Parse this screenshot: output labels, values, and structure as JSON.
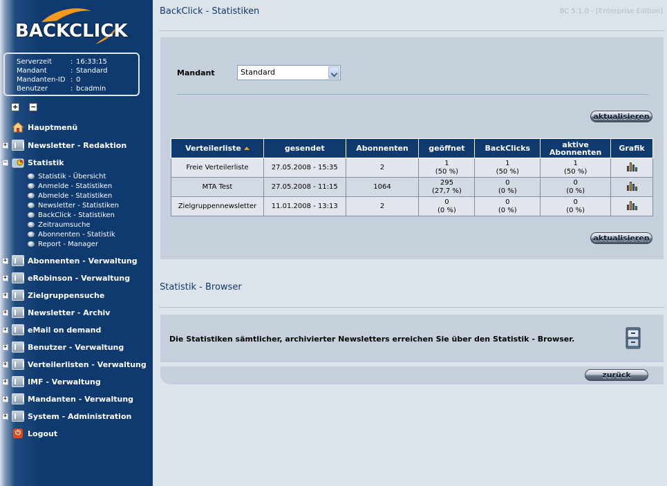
{
  "logo_text": "BACKCLICK",
  "server_info": [
    {
      "key": "Serverzeit",
      "value": "16:33:15"
    },
    {
      "key": "Mandant",
      "value": "Standard"
    },
    {
      "key": "Mandanten-ID",
      "value": "0"
    },
    {
      "key": "Benutzer",
      "value": "bcadmin"
    }
  ],
  "info_separator": ":",
  "tree_controls": {
    "expand": "+",
    "collapse": "−"
  },
  "nav": {
    "hauptmenue": "Hauptmenü",
    "newsletter_redaktion": "Newsletter - Redaktion",
    "statistik": "Statistik",
    "statistik_sub": [
      "Statistik - Übersicht",
      "Anmelde - Statistiken",
      "Abmelde - Statistiken",
      "Newsletter - Statistiken",
      "BackClick - Statistiken",
      "Zeitraumsuche",
      "Abonnenten - Statistik",
      "Report - Manager"
    ],
    "abonnenten_verwaltung": "Abonnenten - Verwaltung",
    "erobinson_verwaltung": "eRobinson - Verwaltung",
    "zielgruppensuche": "Zielgruppensuche",
    "newsletter_archiv": "Newsletter - Archiv",
    "email_on_demand": "eMail on demand",
    "benutzer_verwaltung": "Benutzer - Verwaltung",
    "verteilerlisten_verwaltung": "Verteilerlisten - Verwaltung",
    "imf_verwaltung": "IMF - Verwaltung",
    "mandanten_verwaltung": "Mandanten - Verwaltung",
    "system_administration": "System - Administration",
    "logout": "Logout",
    "toggle_plus": "+",
    "toggle_minus": "−",
    "logout_icon_glyph": "⏻"
  },
  "page_title": "BackClick - Statistiken",
  "version": "BC 5.1.0 - [Enterprise Edition]",
  "mandant": {
    "label": "Mandant",
    "selected": "Standard"
  },
  "buttons": {
    "refresh": "aktualisieren",
    "back": "zurück"
  },
  "table": {
    "headers": {
      "verteilerliste": "Verteilerliste",
      "gesendet": "gesendet",
      "abonnenten": "Abonnenten",
      "geoeffnet": "geöffnet",
      "backclicks": "BackClicks",
      "aktive_1": "aktive",
      "aktive_2": "Abonnenten",
      "grafik": "Grafik"
    },
    "rows": [
      {
        "liste": "Freie Verteilerliste",
        "gesendet": "27.05.2008 - 15:35",
        "abonnenten": "2",
        "geoeffnet_n": "1",
        "geoeffnet_p": "(50 %)",
        "backclicks_n": "1",
        "backclicks_p": "(50 %)",
        "aktive_n": "1",
        "aktive_p": "(50 %)"
      },
      {
        "liste": "MTA Test",
        "gesendet": "27.05.2008 - 11:15",
        "abonnenten": "1064",
        "geoeffnet_n": "295",
        "geoeffnet_p": "(27,7 %)",
        "backclicks_n": "0",
        "backclicks_p": "(0 %)",
        "aktive_n": "0",
        "aktive_p": "(0 %)"
      },
      {
        "liste": "Zielgruppennewsletter",
        "gesendet": "11.01.2008 - 13:13",
        "abonnenten": "2",
        "geoeffnet_n": "0",
        "geoeffnet_p": "(0 %)",
        "backclicks_n": "0",
        "backclicks_p": "(0 %)",
        "aktive_n": "0",
        "aktive_p": "(0 %)"
      }
    ]
  },
  "browser": {
    "title": "Statistik - Browser",
    "text": "Die Statistiken sämtlicher, archivierter Newsletters erreichen Sie über den Statistik - Browser."
  },
  "colors": {
    "nav_bg": "#0e3a70",
    "header_bg": "#0e3a70",
    "panel_bg": "#c5d0dc",
    "logo_orange": "#f39a1e"
  }
}
